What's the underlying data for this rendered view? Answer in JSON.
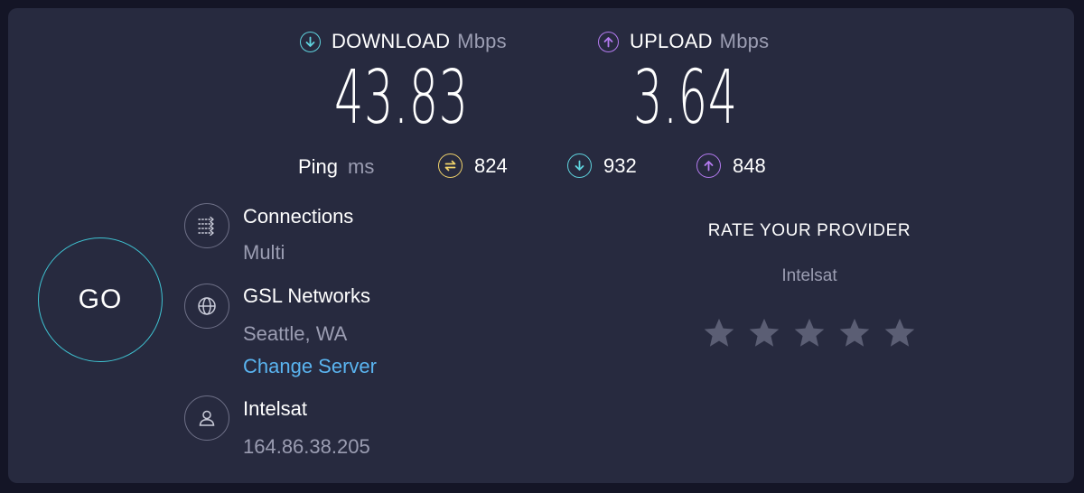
{
  "download": {
    "label": "DOWNLOAD",
    "unit": "Mbps",
    "value": "43.83",
    "icon": "arrow-down-circle-icon",
    "color": "#5fd3de"
  },
  "upload": {
    "label": "UPLOAD",
    "unit": "Mbps",
    "value": "3.64",
    "icon": "arrow-up-circle-icon",
    "color": "#b47bf0"
  },
  "ping": {
    "label": "Ping",
    "unit": "ms",
    "idle": {
      "value": "824",
      "icon": "ping-idle-icon",
      "color": "#f1d36b"
    },
    "download": {
      "value": "932",
      "icon": "arrow-down-circle-icon",
      "color": "#5fd3de"
    },
    "upload": {
      "value": "848",
      "icon": "arrow-up-circle-icon",
      "color": "#b47bf0"
    }
  },
  "go_label": "GO",
  "connections": {
    "title": "Connections",
    "value": "Multi",
    "icon": "connections-arrows-icon"
  },
  "server": {
    "name": "GSL Networks",
    "location": "Seattle, WA",
    "change_label": "Change Server",
    "icon": "globe-icon"
  },
  "provider": {
    "name": "Intelsat",
    "ip": "164.86.38.205",
    "icon": "user-icon"
  },
  "rate": {
    "title": "RATE YOUR PROVIDER",
    "provider": "Intelsat",
    "stars_total": 5,
    "stars_selected": 0
  },
  "colors": {
    "background": "#141526",
    "panel": "#272a3f",
    "accent_go": "#3fc3d2",
    "link": "#5ab4f0",
    "muted": "#9b9db2",
    "star": "#5b5e74"
  }
}
